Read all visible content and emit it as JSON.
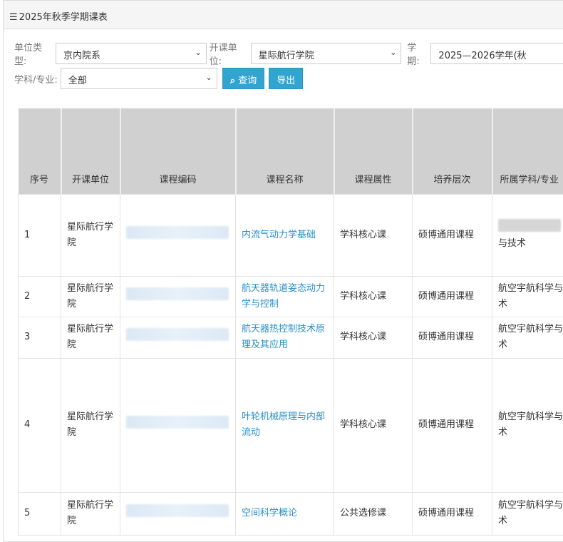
{
  "title": "2025年秋季学期课表",
  "filters": {
    "unit_type_label": "单位类型:",
    "unit_type": "京内院系",
    "dept_label": "开课单位:",
    "dept": "星际航行学院",
    "term_label": "学期:",
    "term": "2025—2026学年(秋",
    "subject_label": "学科/专业:",
    "subject": "全部",
    "query_button": "查询",
    "export_button": "导出"
  },
  "columns": [
    "序号",
    "开课单位",
    "课程编码",
    "课程名称",
    "课程属性",
    "培养层次",
    "所属学科/专业"
  ],
  "rows": [
    {
      "no": "1",
      "dept": "星际航行学院",
      "name": "内流气动力学基础",
      "attr": "学科核心课",
      "level": "硕博通用课程",
      "subject": "与技术"
    },
    {
      "no": "2",
      "dept": "星际航行学院",
      "name": "航天器轨道姿态动力学与控制",
      "attr": "学科核心课",
      "level": "硕博通用课程",
      "subject": "航空宇航科学与技术"
    },
    {
      "no": "3",
      "dept": "星际航行学院",
      "name": "航天器热控制技术原理及其应用",
      "attr": "学科核心课",
      "level": "硕博通用课程",
      "subject": "航空宇航科学与技术"
    },
    {
      "no": "4",
      "dept": "星际航行学院",
      "name": "叶轮机械原理与内部流动",
      "attr": "学科核心课",
      "level": "硕博通用课程",
      "subject": "航空宇航科学与技术"
    },
    {
      "no": "5",
      "dept": "星际航行学院",
      "name": "空间科学概论",
      "attr": "公共选修课",
      "level": "硕博通用课程",
      "subject": "航空宇航科学与技术"
    }
  ]
}
